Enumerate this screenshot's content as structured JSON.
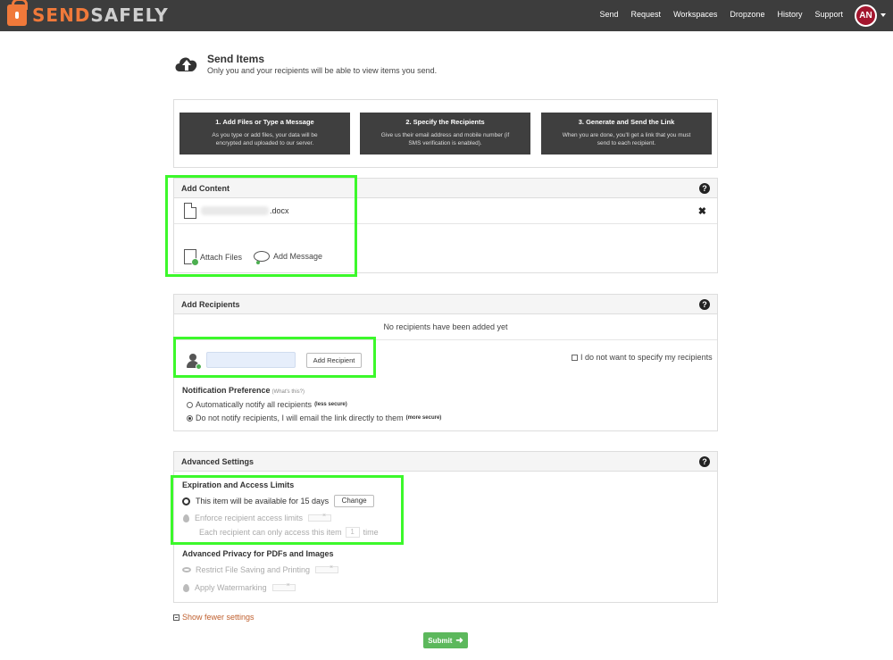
{
  "colors": {
    "topbar": "#3d3d3d",
    "brand_orange": "#f0793a",
    "highlight": "#3cf82b",
    "submit": "#5cb85c",
    "avatar": "#a3162e"
  },
  "header": {
    "logo_part1": "SEND",
    "logo_part2": "SAFELY",
    "nav": [
      "Send",
      "Request",
      "Workspaces",
      "Dropzone",
      "History",
      "Support"
    ],
    "avatar_initials": "AN"
  },
  "page": {
    "title": "Send Items",
    "subtitle": "Only you and your recipients will be able to view items you send."
  },
  "steps": [
    {
      "title": "1. Add Files or Type a Message",
      "desc": "As you type or add files, your data will be encrypted and uploaded to our server."
    },
    {
      "title": "2. Specify the Recipients",
      "desc": "Give us their email address and mobile number (if SMS verification is enabled)."
    },
    {
      "title": "3. Generate and Send the Link",
      "desc": "When you are done, you'll get a link that you must send to each recipient."
    }
  ],
  "add_content": {
    "title": "Add Content",
    "help": "?",
    "file_ext": ".docx",
    "remove": "✖",
    "attach_label": "Attach Files",
    "message_label": "Add Message"
  },
  "recipients": {
    "title": "Add Recipients",
    "help": "?",
    "empty_text": "No recipients have been added yet",
    "input_value": "",
    "add_button": "Add Recipient",
    "no_specify_label": "I do not want to specify my recipients",
    "notif_title": "Notification Preference",
    "notif_whats": "(What's this?)",
    "auto_label": "Automatically notify all recipients",
    "auto_note": "(less secure)",
    "manual_label": "Do not notify recipients, I will email the link directly to them",
    "manual_note": "(more secure)"
  },
  "advanced": {
    "title": "Advanced Settings",
    "help": "?",
    "expiration_title": "Expiration and Access Limits",
    "available_text": "This item will be available for 15 days",
    "change_button": "Change",
    "enforce_label": "Enforce recipient access limits",
    "each_prefix": "Each recipient can only access this item",
    "each_value": "1",
    "each_suffix": "time",
    "privacy_title": "Advanced Privacy for PDFs and Images",
    "restrict_label": "Restrict File Saving and Printing",
    "watermark_label": "Apply Watermarking"
  },
  "show_fewer": "Show fewer settings",
  "submit": {
    "label": "Submit",
    "arrow": "➜"
  }
}
